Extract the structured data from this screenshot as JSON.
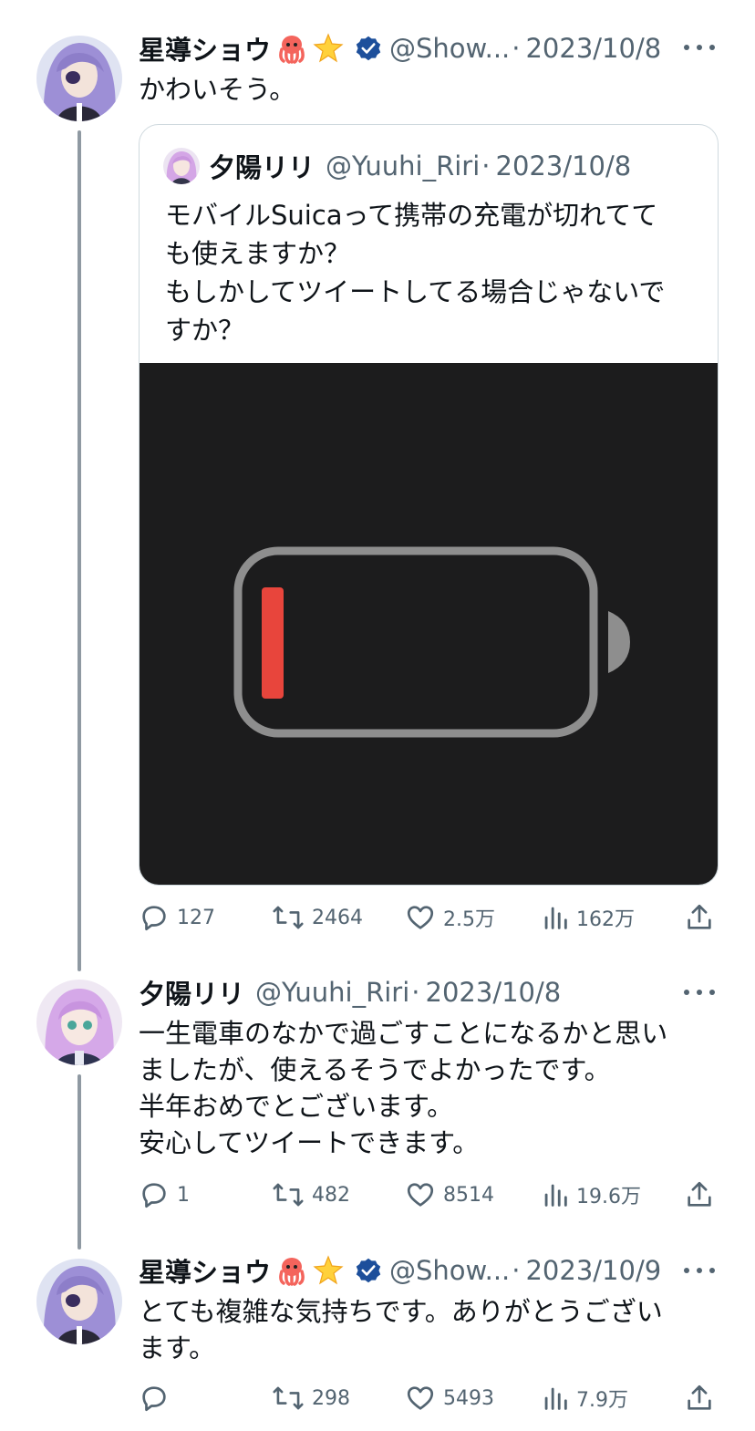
{
  "colors": {
    "text": "#0f1419",
    "secondary": "#536471",
    "verified": "#1d9bf0",
    "border": "#cfd9de",
    "battery_red": "#e8453c"
  },
  "tweets": [
    {
      "author": "星導ショウ",
      "emojis": [
        "octopus-emoji",
        "star-emoji"
      ],
      "verified": true,
      "handle": "@Show...",
      "sep": "·",
      "date": "2023/10/8",
      "text": "かわいそう。",
      "quote": {
        "author": "夕陽リリ",
        "handle": "@Yuuhi_Riri",
        "sep": "·",
        "date": "2023/10/8",
        "text": "モバイルSuicaって携帯の充電が切れてて\nも使えますか？\nもしかしてツイートしてる場合じゃないで\nすか？",
        "media": {
          "icon": "low-battery-icon",
          "battery_level": 0.1
        }
      },
      "stats": {
        "replies": "127",
        "retweets": "2464",
        "likes": "2.5万",
        "views": "162万"
      }
    },
    {
      "author": "夕陽リリ",
      "handle": "@Yuuhi_Riri",
      "sep": "·",
      "date": "2023/10/8",
      "text": "一生電車のなかで過ごすことになるかと思い\nましたが、使えるそうでよかったです。\n半年おめでとございます。\n安心してツイートできます。",
      "stats": {
        "replies": "1",
        "retweets": "482",
        "likes": "8514",
        "views": "19.6万"
      }
    },
    {
      "author": "星導ショウ",
      "emojis": [
        "octopus-emoji",
        "star-emoji"
      ],
      "verified": true,
      "handle": "@Show...",
      "sep": "·",
      "date": "2023/10/9",
      "text": "とても複雑な気持ちです。ありがとうござい\nます。",
      "stats": {
        "replies": "",
        "retweets": "298",
        "likes": "5493",
        "views": "7.9万"
      }
    }
  ]
}
